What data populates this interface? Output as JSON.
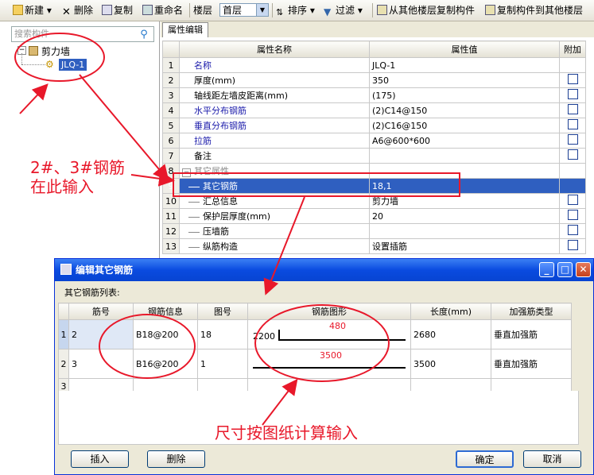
{
  "toolbar": {
    "new": "新建",
    "delete": "删除",
    "copy": "复制",
    "rename": "重命名",
    "floor_label": "楼层",
    "floor_value": "首层",
    "sort": "排序",
    "filter": "过滤",
    "copy_from_floor": "从其他楼层复制构件",
    "copy_to_floor": "复制构件到其他楼层"
  },
  "left": {
    "search_placeholder": "搜索构件",
    "tree_root": "剪力墙",
    "tree_child": "JLQ-1"
  },
  "tab": "属性编辑",
  "grid": {
    "headers": [
      "属性名称",
      "属性值",
      "附加"
    ],
    "rows": [
      {
        "n": "1",
        "name": "名称",
        "value": "JLQ-1",
        "blue": true,
        "check": false
      },
      {
        "n": "2",
        "name": "厚度(mm)",
        "value": "350",
        "blue": false,
        "check": true
      },
      {
        "n": "3",
        "name": "轴线距左墙皮距离(mm)",
        "value": "(175)",
        "blue": false,
        "check": true
      },
      {
        "n": "4",
        "name": "水平分布钢筋",
        "value": "(2)C14@150",
        "blue": true,
        "check": true
      },
      {
        "n": "5",
        "name": "垂直分布钢筋",
        "value": "(2)C16@150",
        "blue": true,
        "check": true
      },
      {
        "n": "6",
        "name": "拉筋",
        "value": "A6@600*600",
        "blue": true,
        "check": true
      },
      {
        "n": "7",
        "name": "备注",
        "value": "",
        "blue": false,
        "check": true
      },
      {
        "n": "8",
        "name": "其它属性",
        "value": "",
        "group": true
      },
      {
        "n": "9",
        "name": "其它钢筋",
        "value": "18,1",
        "selected": true
      },
      {
        "n": "10",
        "name": "汇总信息",
        "value": "剪力墙",
        "check": true
      },
      {
        "n": "11",
        "name": "保护层厚度(mm)",
        "value": "20",
        "check": true
      },
      {
        "n": "12",
        "name": "压墙筋",
        "value": "",
        "check": true
      },
      {
        "n": "13",
        "name": "纵筋构造",
        "value": "设置插筋",
        "check": true
      }
    ]
  },
  "dialog": {
    "title": "编辑其它钢筋",
    "list_label": "其它钢筋列表:",
    "headers": [
      "筋号",
      "钢筋信息",
      "图号",
      "钢筋图形",
      "长度(mm)",
      "加强筋类型"
    ],
    "rows": [
      {
        "n": "1",
        "bar_no": "2",
        "info": "B18@200",
        "shape_no": "18",
        "dim_left": "2200",
        "dim_top": "480",
        "length": "2680",
        "type": "垂直加强筋"
      },
      {
        "n": "2",
        "bar_no": "3",
        "info": "B16@200",
        "shape_no": "1",
        "dim_left": "",
        "dim_top": "3500",
        "length": "3500",
        "type": "垂直加强筋"
      },
      {
        "n": "3",
        "bar_no": "",
        "info": "",
        "shape_no": "",
        "dim_left": "",
        "dim_top": "",
        "length": "",
        "type": ""
      }
    ],
    "insert": "插入",
    "delete": "删除",
    "ok": "确定",
    "cancel": "取消"
  },
  "annotations": {
    "note1_line1": "2#、3#钢筋",
    "note1_line2": "在此输入",
    "note2": "尺寸按图纸计算输入"
  },
  "colors": {
    "annotation": "#e8182a",
    "selection": "#2f5fc0",
    "title_bar": "#0a4be0"
  }
}
